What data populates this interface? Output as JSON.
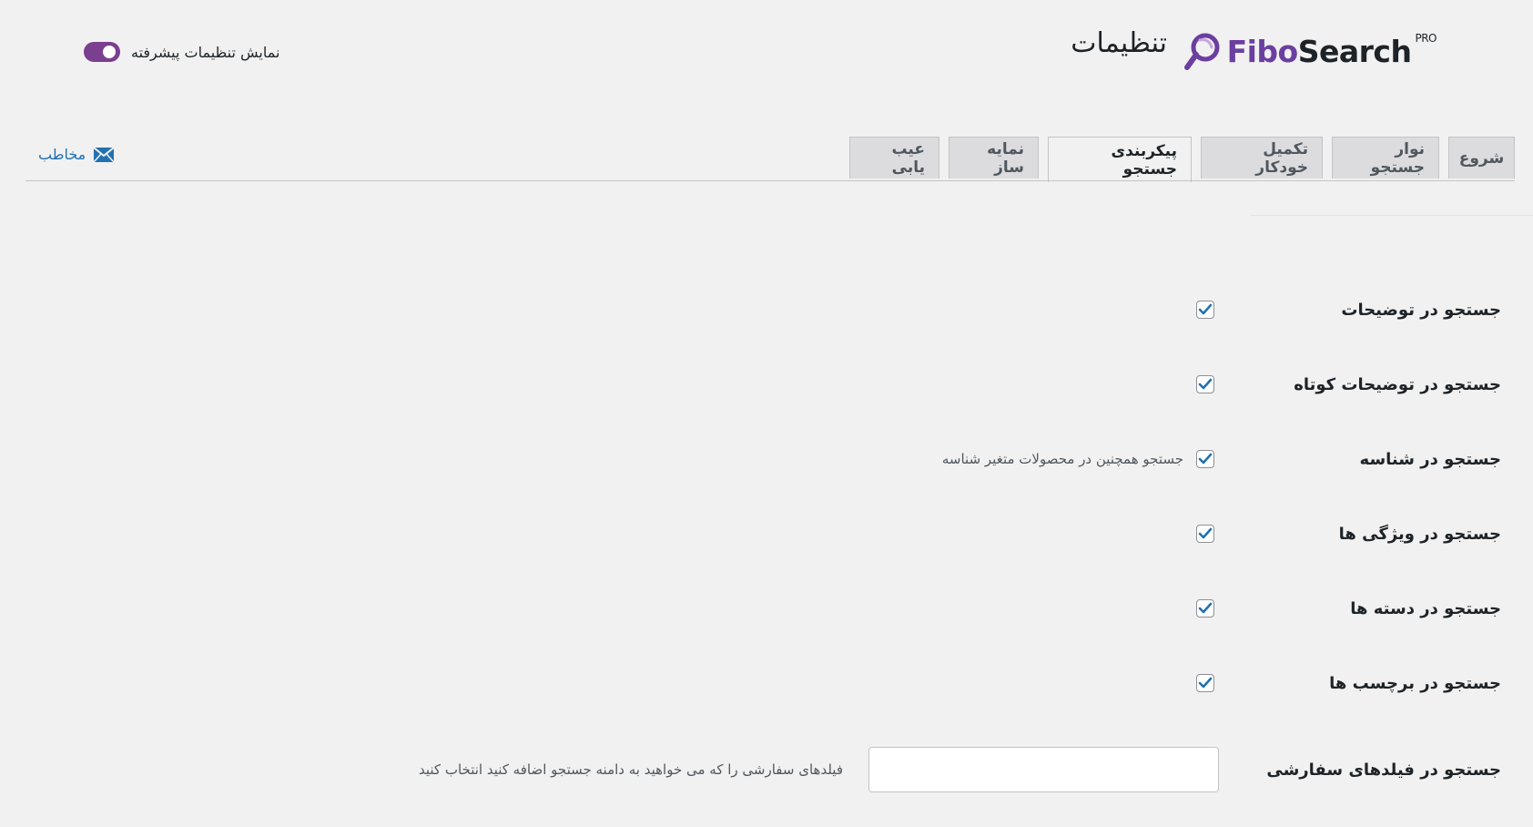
{
  "header": {
    "logo_part1": "Fibo",
    "logo_part2": "Search",
    "logo_badge": "PRO",
    "title": "تنظیمات",
    "advanced_toggle_label": "نمایش تنظیمات پیشرفته",
    "advanced_toggle_on": true
  },
  "tabs": [
    {
      "label": "شروع",
      "active": false
    },
    {
      "label": "نوار جستجو",
      "active": false
    },
    {
      "label": "تکمیل خودکار",
      "active": false
    },
    {
      "label": "پیکربندی جستجو",
      "active": true
    },
    {
      "label": "نمایه ساز",
      "active": false
    },
    {
      "label": "عیب یابی",
      "active": false
    }
  ],
  "contact": {
    "label": "مخاطب",
    "icon": "envelope-icon"
  },
  "settings": {
    "description": {
      "label": "جستجو در توضیحات",
      "checked": true
    },
    "short_description": {
      "label": "جستجو در توضیحات کوتاه",
      "checked": true
    },
    "sku": {
      "label": "جستجو در شناسه",
      "checked": true,
      "note": "جستجو همچنین در محصولات متغیر شناسه"
    },
    "attributes": {
      "label": "جستجو در ویژگی ها",
      "checked": true
    },
    "categories": {
      "label": "جستجو در دسته ها",
      "checked": true
    },
    "tags": {
      "label": "جستجو در برچسب ها",
      "checked": true
    },
    "custom_fields": {
      "label": "جستجو در فیلدهای سفارشی",
      "value": "",
      "note": "فیلدهای سفارشی را که می خواهید به دامنه جستجو اضافه کنید انتخاب کنید"
    }
  },
  "colors": {
    "brand": "#6b3fa0",
    "toggle": "#7b3f8f",
    "link": "#2271b1",
    "check": "#2271b1"
  }
}
